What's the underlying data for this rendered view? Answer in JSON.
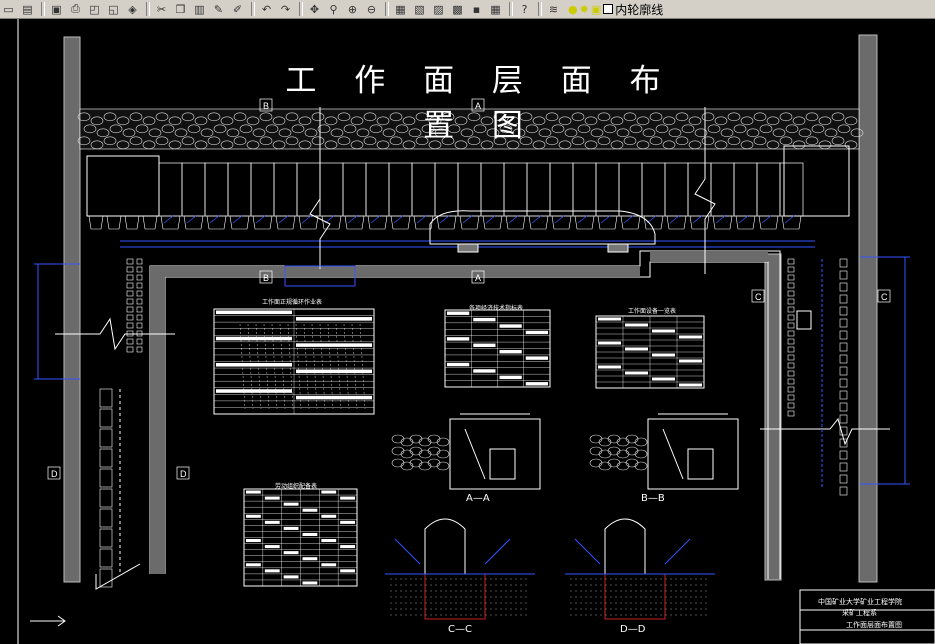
{
  "toolbar": {
    "icons": [
      "new-icon",
      "open-icon",
      "save-icon",
      "print-icon",
      "preview-icon",
      "publish-icon",
      "3d-dwf-icon",
      "cut-icon",
      "copy-icon",
      "paste-icon",
      "matchprop-icon",
      "brush-icon",
      "undo-icon",
      "redo-icon",
      "pan-icon",
      "zoom-realtime-icon",
      "zoom-window-icon",
      "zoom-previous-icon",
      "properties-icon",
      "design-center-icon",
      "tool-palette-icon",
      "sheet-set-icon",
      "markup-icon",
      "calculator-icon",
      "help-icon",
      "layer-manager-icon"
    ],
    "layer_name": "内轮廓线"
  },
  "drawing": {
    "title": "工 作 面 层 面 布 置 图",
    "section_marks": [
      "B",
      "A",
      "B",
      "A",
      "C",
      "C",
      "D",
      "D"
    ],
    "table_titles": [
      "工作面正规循环作业表",
      "各项经济技术指标表",
      "工作面设备一览表",
      "劳动组织配备表"
    ],
    "section_titles": [
      "A—A",
      "B—B",
      "C—C",
      "D—D"
    ],
    "title_block": {
      "line1": "中国矿业大学矿业工程学院",
      "line2": "采矿工程系",
      "line3": "工作面层面布置图"
    }
  }
}
